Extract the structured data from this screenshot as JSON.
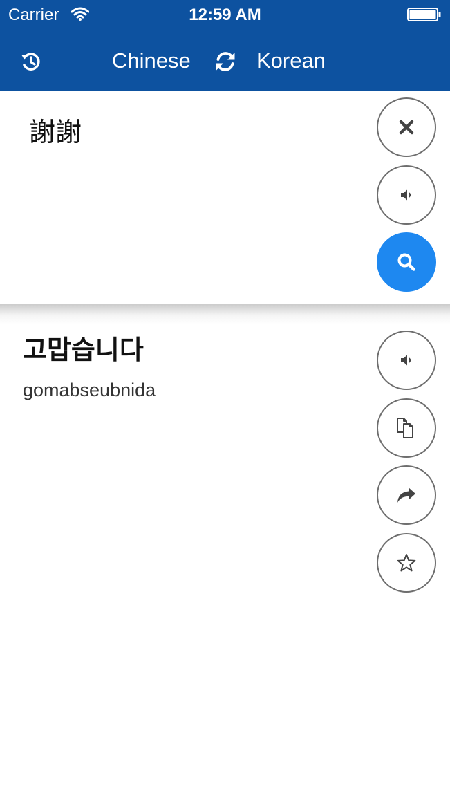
{
  "status_bar": {
    "carrier": "Carrier",
    "time": "12:59 AM"
  },
  "nav": {
    "source_language": "Chinese",
    "target_language": "Korean",
    "history_icon": "history-icon",
    "swap_icon": "swap-languages-icon"
  },
  "input": {
    "text": "謝謝",
    "buttons": [
      {
        "name": "clear",
        "icon": "close-icon"
      },
      {
        "name": "speak",
        "icon": "speaker-icon"
      },
      {
        "name": "translate",
        "icon": "search-icon"
      }
    ]
  },
  "result": {
    "text": "고맙습니다",
    "romanization": "gomabseubnida",
    "buttons": [
      {
        "name": "speak",
        "icon": "speaker-icon"
      },
      {
        "name": "copy",
        "icon": "copy-icon"
      },
      {
        "name": "share",
        "icon": "share-icon"
      },
      {
        "name": "favorite",
        "icon": "star-icon"
      }
    ]
  },
  "colors": {
    "nav_background": "#0d52a0",
    "primary_button": "#1e88f0",
    "button_border": "#6e6e6e"
  }
}
